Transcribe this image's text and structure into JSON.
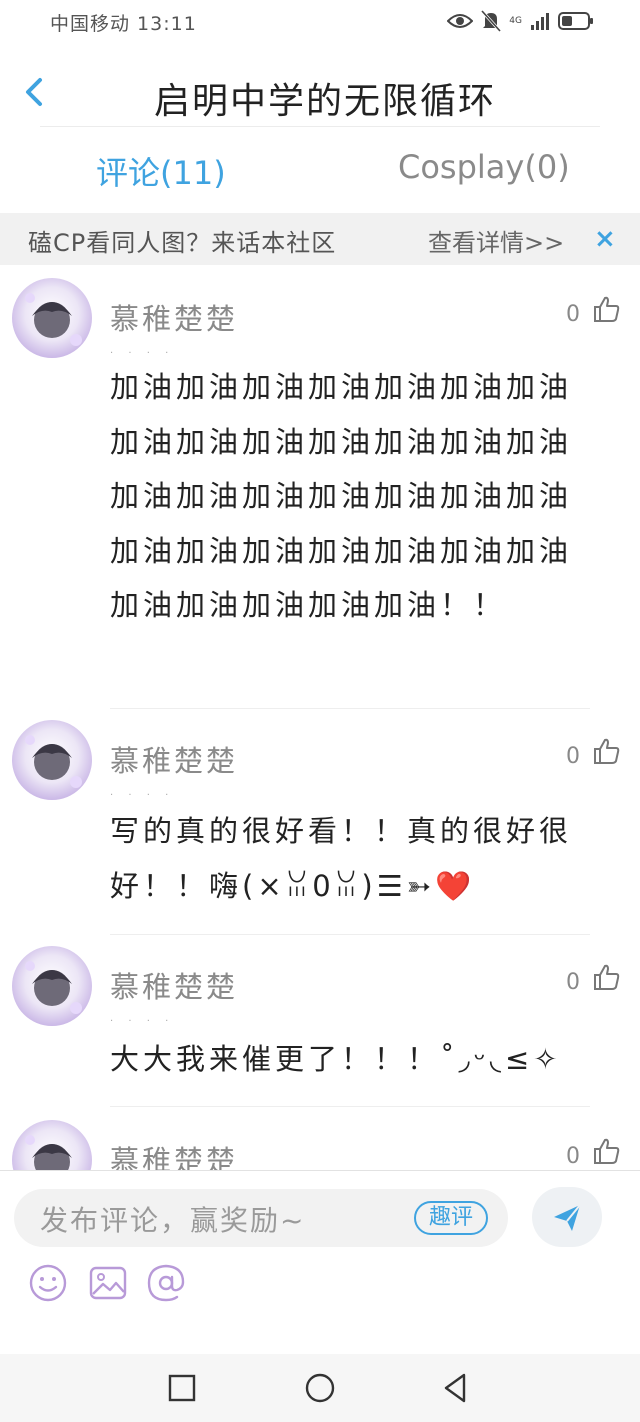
{
  "status_bar": {
    "carrier_time": "中国移动 13:11",
    "network": "4G"
  },
  "header": {
    "title": "启明中学的无限循环"
  },
  "tabs": [
    {
      "label": "评论(11)",
      "active": true
    },
    {
      "label": "Cosplay(0)",
      "active": false
    }
  ],
  "banner": {
    "text": "磕CP看同人图？来话本社区",
    "link": "查看详情>>",
    "close": "×"
  },
  "comments": [
    {
      "username": "慕稚楚楚",
      "likes": "0",
      "text": "加油加油加油加油加油加油加油加油加油加油加油加油加油加油加油加油加油加油加油加油加油加油加油加油加油加油加油加油加油加油加油加油加油！！"
    },
    {
      "username": "慕稚楚楚",
      "likes": "0",
      "text": "写的真的很好看！！真的很好很好！！嗨(×ꈍ0ꈍ)☰➳❤️"
    },
    {
      "username": "慕稚楚楚",
      "likes": "0",
      "text": "大大我来催更了！！！˚◞ᵕ◟≤✧"
    },
    {
      "username": "慕稚楚楚",
      "likes": "0",
      "text": ""
    }
  ],
  "composer": {
    "placeholder": "发布评论，赢奖励~",
    "quping_label": "趣评"
  },
  "colors": {
    "accent": "#3fa3e0",
    "muted": "#8a8a8a"
  },
  "icons": {
    "tools": [
      "emoji-icon",
      "image-icon",
      "at-icon"
    ],
    "nav": [
      "recent-apps-icon",
      "home-icon",
      "back-icon"
    ]
  }
}
